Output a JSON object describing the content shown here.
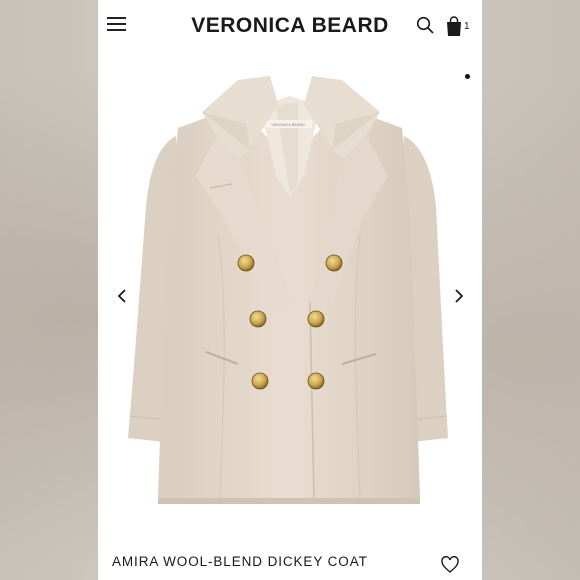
{
  "header": {
    "brand": "VERONICA BEARD",
    "cart_count": "1",
    "icons": [
      "menu-icon",
      "search-icon",
      "shopping-bag-icon"
    ]
  },
  "gallery": {
    "prev_icon": "chevron-left-icon",
    "next_icon": "chevron-right-icon",
    "label_text": "VERONICA BEARD"
  },
  "product": {
    "title": "AMIRA WOOL-BLEND DICKEY COAT",
    "favorite_icon": "heart-icon"
  },
  "colors": {
    "coat": "#e3d8cb",
    "buttons": "#c9a54e",
    "text": "#1a1a1a"
  }
}
